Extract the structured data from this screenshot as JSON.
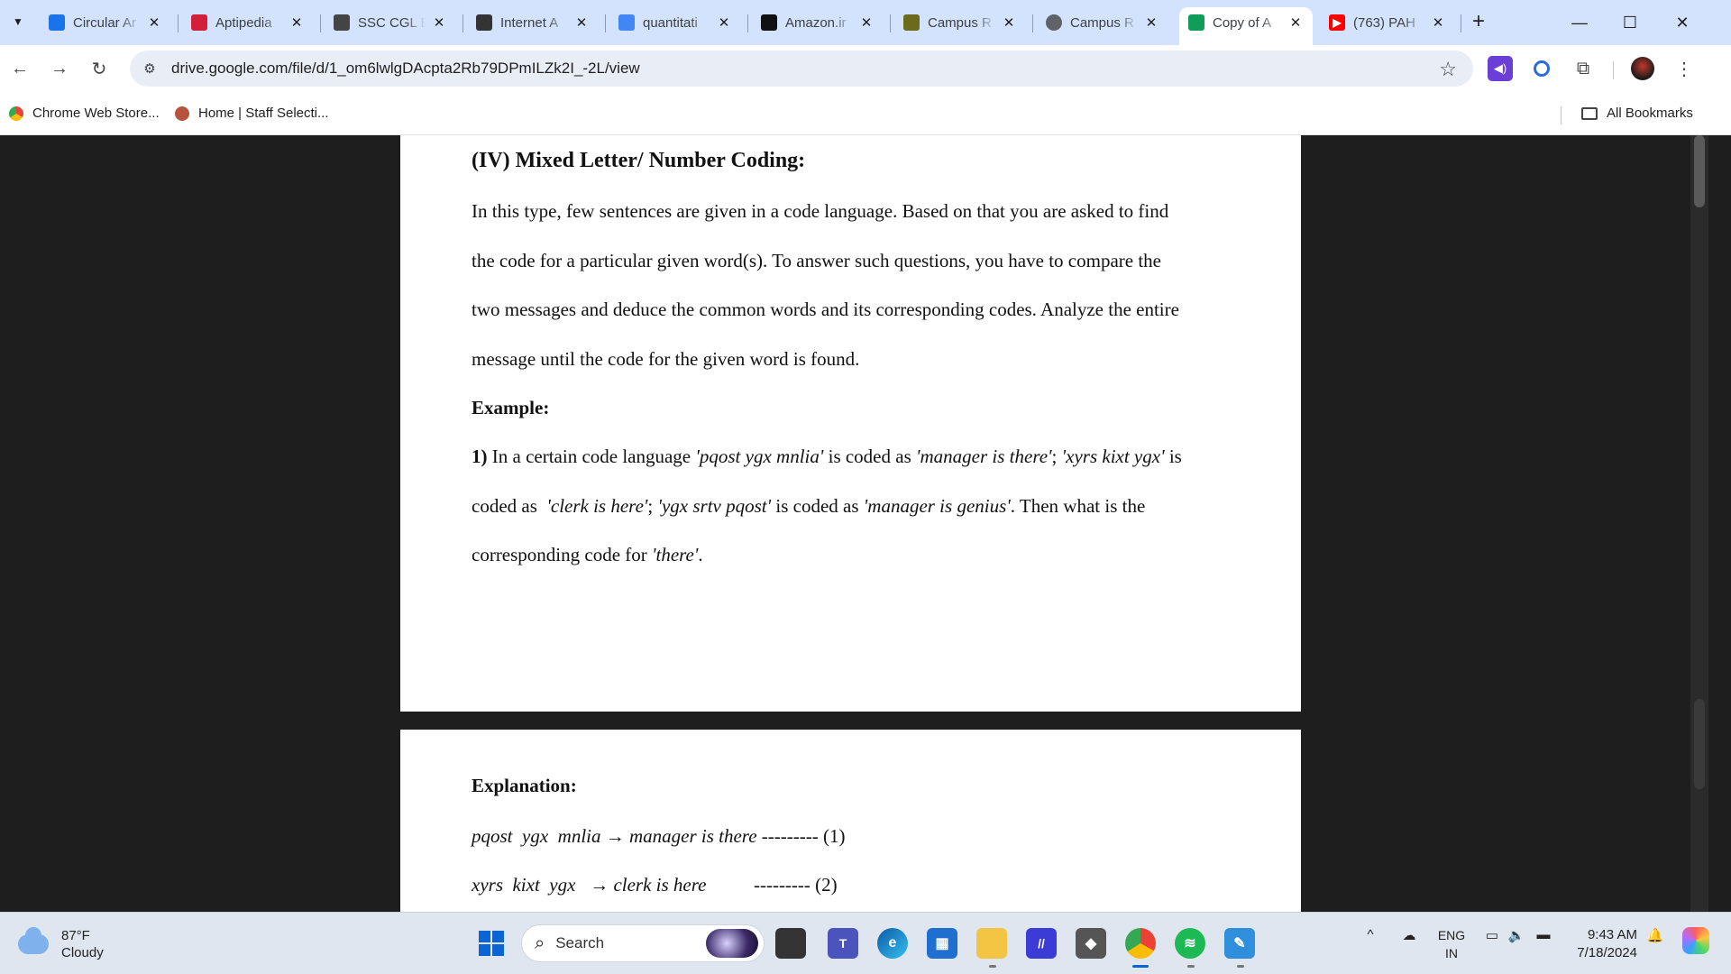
{
  "browser": {
    "tabs": [
      {
        "label": "Circular Ar",
        "favicon_color": "#1a73e8",
        "active": false
      },
      {
        "label": "Aptipedia",
        "favicon_color": "#d21f3c",
        "active": false
      },
      {
        "label": "SSC CGL E",
        "favicon_color": "#444444",
        "active": false
      },
      {
        "label": "Internet A",
        "favicon_color": "#333333",
        "active": false
      },
      {
        "label": "quantitati",
        "favicon_color": "#4285f4",
        "active": false
      },
      {
        "label": "Amazon.ir",
        "favicon_color": "#111111",
        "active": false
      },
      {
        "label": "Campus R",
        "favicon_color": "#6b6b1e",
        "active": false
      },
      {
        "label": "Campus R",
        "favicon_color": "#5f6368",
        "active": false
      },
      {
        "label": "Copy of A",
        "favicon_color": "#0f9d58",
        "active": true
      },
      {
        "label": "(763) PAH",
        "favicon_color": "#ff0000",
        "active": false
      }
    ],
    "url": "drive.google.com/file/d/1_om6lwlgDAcpta2Rb79DPmILZk2I_-2L/view",
    "bookmarks": [
      {
        "label": "Chrome Web Store..."
      },
      {
        "label": "Home | Staff Selecti..."
      }
    ],
    "all_bookmarks": "All Bookmarks"
  },
  "document": {
    "heading": "(IV) Mixed Letter/ Number Coding:",
    "para_lines": [
      "In this type, few sentences are given in a code language. Based on that you are asked to find",
      "the code for a particular given word(s). To answer such questions, you have to compare the",
      "two messages and deduce the common words and its corresponding codes. Analyze the entire",
      "message until the code for the given word is found."
    ],
    "example_label": "Example:",
    "q_number": "1)",
    "q_line1_a": "In a certain code language ",
    "q_line1_b": "'pqost ygx mnlia'",
    "q_line1_c": " is coded as ",
    "q_line1_d": "'manager is there'",
    "q_line1_e": "; ",
    "q_line1_f": "'xyrs kixt ygx'",
    "q_line1_g": " is",
    "q_line2_a": "coded as  ",
    "q_line2_b": "'clerk is here'",
    "q_line2_c": "; ",
    "q_line2_d": "'ygx srtv pqost'",
    "q_line2_e": " is coded as ",
    "q_line2_f": "'manager is genius'",
    "q_line2_g": ". Then what is the",
    "q_line3_a": "corresponding code for ",
    "q_line3_b": "'there'",
    "q_line3_c": ".",
    "explanation_label": "Explanation:",
    "exp1_code": "pqost  ygx  mnlia",
    "exp1_meaning": "manager is there",
    "exp1_ref": "--------- (1)",
    "exp2_code": "xyrs  kixt  ygx",
    "exp2_meaning": "clerk is here",
    "exp2_ref": "--------- (2)"
  },
  "taskbar": {
    "temperature": "87°F",
    "condition": "Cloudy",
    "search_placeholder": "Search",
    "lang_line1": "ENG",
    "lang_line2": "IN",
    "time": "9:43 AM",
    "date": "7/18/2024"
  }
}
